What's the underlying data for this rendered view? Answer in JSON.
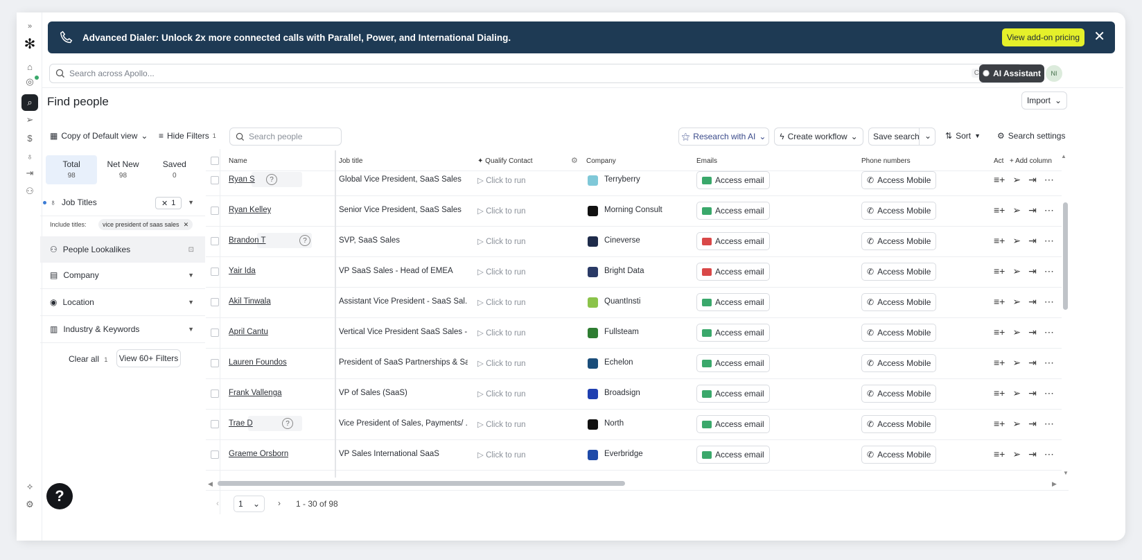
{
  "banner": {
    "text": "Advanced Dialer: Unlock 2x more connected calls with Parallel, Power, and International Dialing.",
    "cta": "View add-on pricing",
    "close": "✕"
  },
  "search": {
    "placeholder": "Search across Apollo...",
    "kbd1": "Ctrl",
    "kbd2": "K"
  },
  "ai_assistant": "AI Assistant",
  "avatar": "NI",
  "page_title": "Find people",
  "import_label": "Import",
  "toolbar": {
    "view": "Copy of Default view",
    "hide_filters": "Hide Filters",
    "hide_filters_count": "1",
    "search_people": "Search people",
    "research_ai": "Research with AI",
    "create_workflow": "Create workflow",
    "save_search": "Save search",
    "sort": "Sort",
    "search_settings": "Search settings"
  },
  "tabs": [
    {
      "label": "Total",
      "count": "98"
    },
    {
      "label": "Net New",
      "count": "98"
    },
    {
      "label": "Saved",
      "count": "0"
    }
  ],
  "filters": {
    "job_titles": "Job Titles",
    "job_titles_count": "1",
    "include_label": "Include titles:",
    "include_chip": "vice president of saas sales",
    "lookalikes": "People Lookalikes",
    "company": "Company",
    "location": "Location",
    "industry": "Industry & Keywords",
    "clear_all": "Clear all",
    "clear_count": "1",
    "view_filters": "View 60+ Filters"
  },
  "columns": {
    "name": "Name",
    "job_title": "Job title",
    "qualify": "Qualify Contact",
    "company": "Company",
    "emails": "Emails",
    "phones": "Phone numbers",
    "actions": "Act",
    "add_column": "Add column"
  },
  "run_label": "Click to run",
  "access_email": "Access email",
  "access_mobile": "Access Mobile",
  "rows": [
    {
      "name": "Ryan S",
      "title": "Global Vice President, SaaS Sales",
      "company": "Terryberry"
    },
    {
      "name": "Ryan Kelley",
      "title": "Senior Vice President, SaaS Sales",
      "company": "Morning Consult"
    },
    {
      "name": "Brandon T",
      "title": "SVP, SaaS Sales",
      "company": "Cineverse"
    },
    {
      "name": "Yair Ida",
      "title": "VP SaaS Sales - Head of EMEA",
      "company": "Bright Data"
    },
    {
      "name": "Akil Tinwala",
      "title": "Assistant Vice President - SaaS Sal...",
      "company": "QuantInsti"
    },
    {
      "name": "April Cantu",
      "title": "Vertical Vice President SaaS Sales -...",
      "company": "Fullsteam"
    },
    {
      "name": "Lauren Foundos",
      "title": "President of SaaS Partnerships & Sa...",
      "company": "Echelon"
    },
    {
      "name": "Frank Vallenga",
      "title": "VP of Sales (SaaS)",
      "company": "Broadsign"
    },
    {
      "name": "Trae D",
      "title": "Vice President of Sales, Payments/ ...",
      "company": "North"
    },
    {
      "name": "Graeme Orsborn",
      "title": "VP Sales International SaaS",
      "company": "Everbridge"
    }
  ],
  "pager": {
    "page": "1",
    "range": "1 - 30 of 98"
  },
  "colors": {
    "banner": "#1e3a54",
    "cta": "#e5f02a",
    "email_ok": "#3aa86b",
    "email_bad": "#d94848"
  }
}
